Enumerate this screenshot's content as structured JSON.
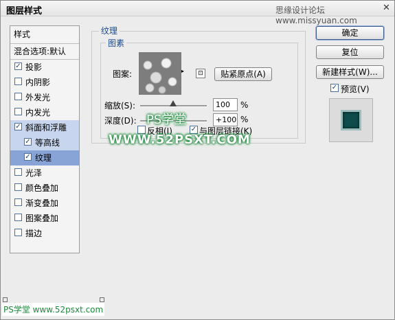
{
  "window": {
    "title": "图层样式",
    "watermark": "思缘设计论坛 www.missyuan.com",
    "close_glyph": "✕"
  },
  "left_panel": {
    "header": "样式",
    "blend_options": "混合选项:默认",
    "items": [
      {
        "label": "投影",
        "checked": true
      },
      {
        "label": "内阴影",
        "checked": false
      },
      {
        "label": "外发光",
        "checked": false
      },
      {
        "label": "内发光",
        "checked": false
      },
      {
        "label": "斜面和浮雕",
        "checked": true
      },
      {
        "label": "等高线",
        "checked": true
      },
      {
        "label": "纹理",
        "checked": true
      },
      {
        "label": "光泽",
        "checked": false
      },
      {
        "label": "颜色叠加",
        "checked": false
      },
      {
        "label": "渐变叠加",
        "checked": false
      },
      {
        "label": "图案叠加",
        "checked": false
      },
      {
        "label": "描边",
        "checked": false
      }
    ]
  },
  "texture": {
    "group_title": "纹理",
    "subgroup_title": "图素",
    "pattern_label": "图案:",
    "snap_button": "贴紧原点(A)",
    "scale_label": "缩放(S):",
    "scale_value": "100",
    "depth_label": "深度(D):",
    "depth_value": "+100",
    "percent": "%",
    "invert_label": "反相(I)",
    "link_label": "与图层链接(K)",
    "link_checked": true,
    "scale_fraction": 0.5,
    "depth_fraction": 0.5
  },
  "right": {
    "ok": "确定",
    "reset": "复位",
    "new_style": "新建样式(W)...",
    "preview_label": "预览(V)",
    "preview_checked": true
  },
  "overlay": {
    "brand": "PS学堂",
    "url": "WWW.52PSXT.COM"
  },
  "footer": {
    "brand": "PS学堂 www.52psxt.com"
  },
  "icons": {
    "checkmark": "✓",
    "dropdown": "▸",
    "new_pattern": "⊡"
  }
}
